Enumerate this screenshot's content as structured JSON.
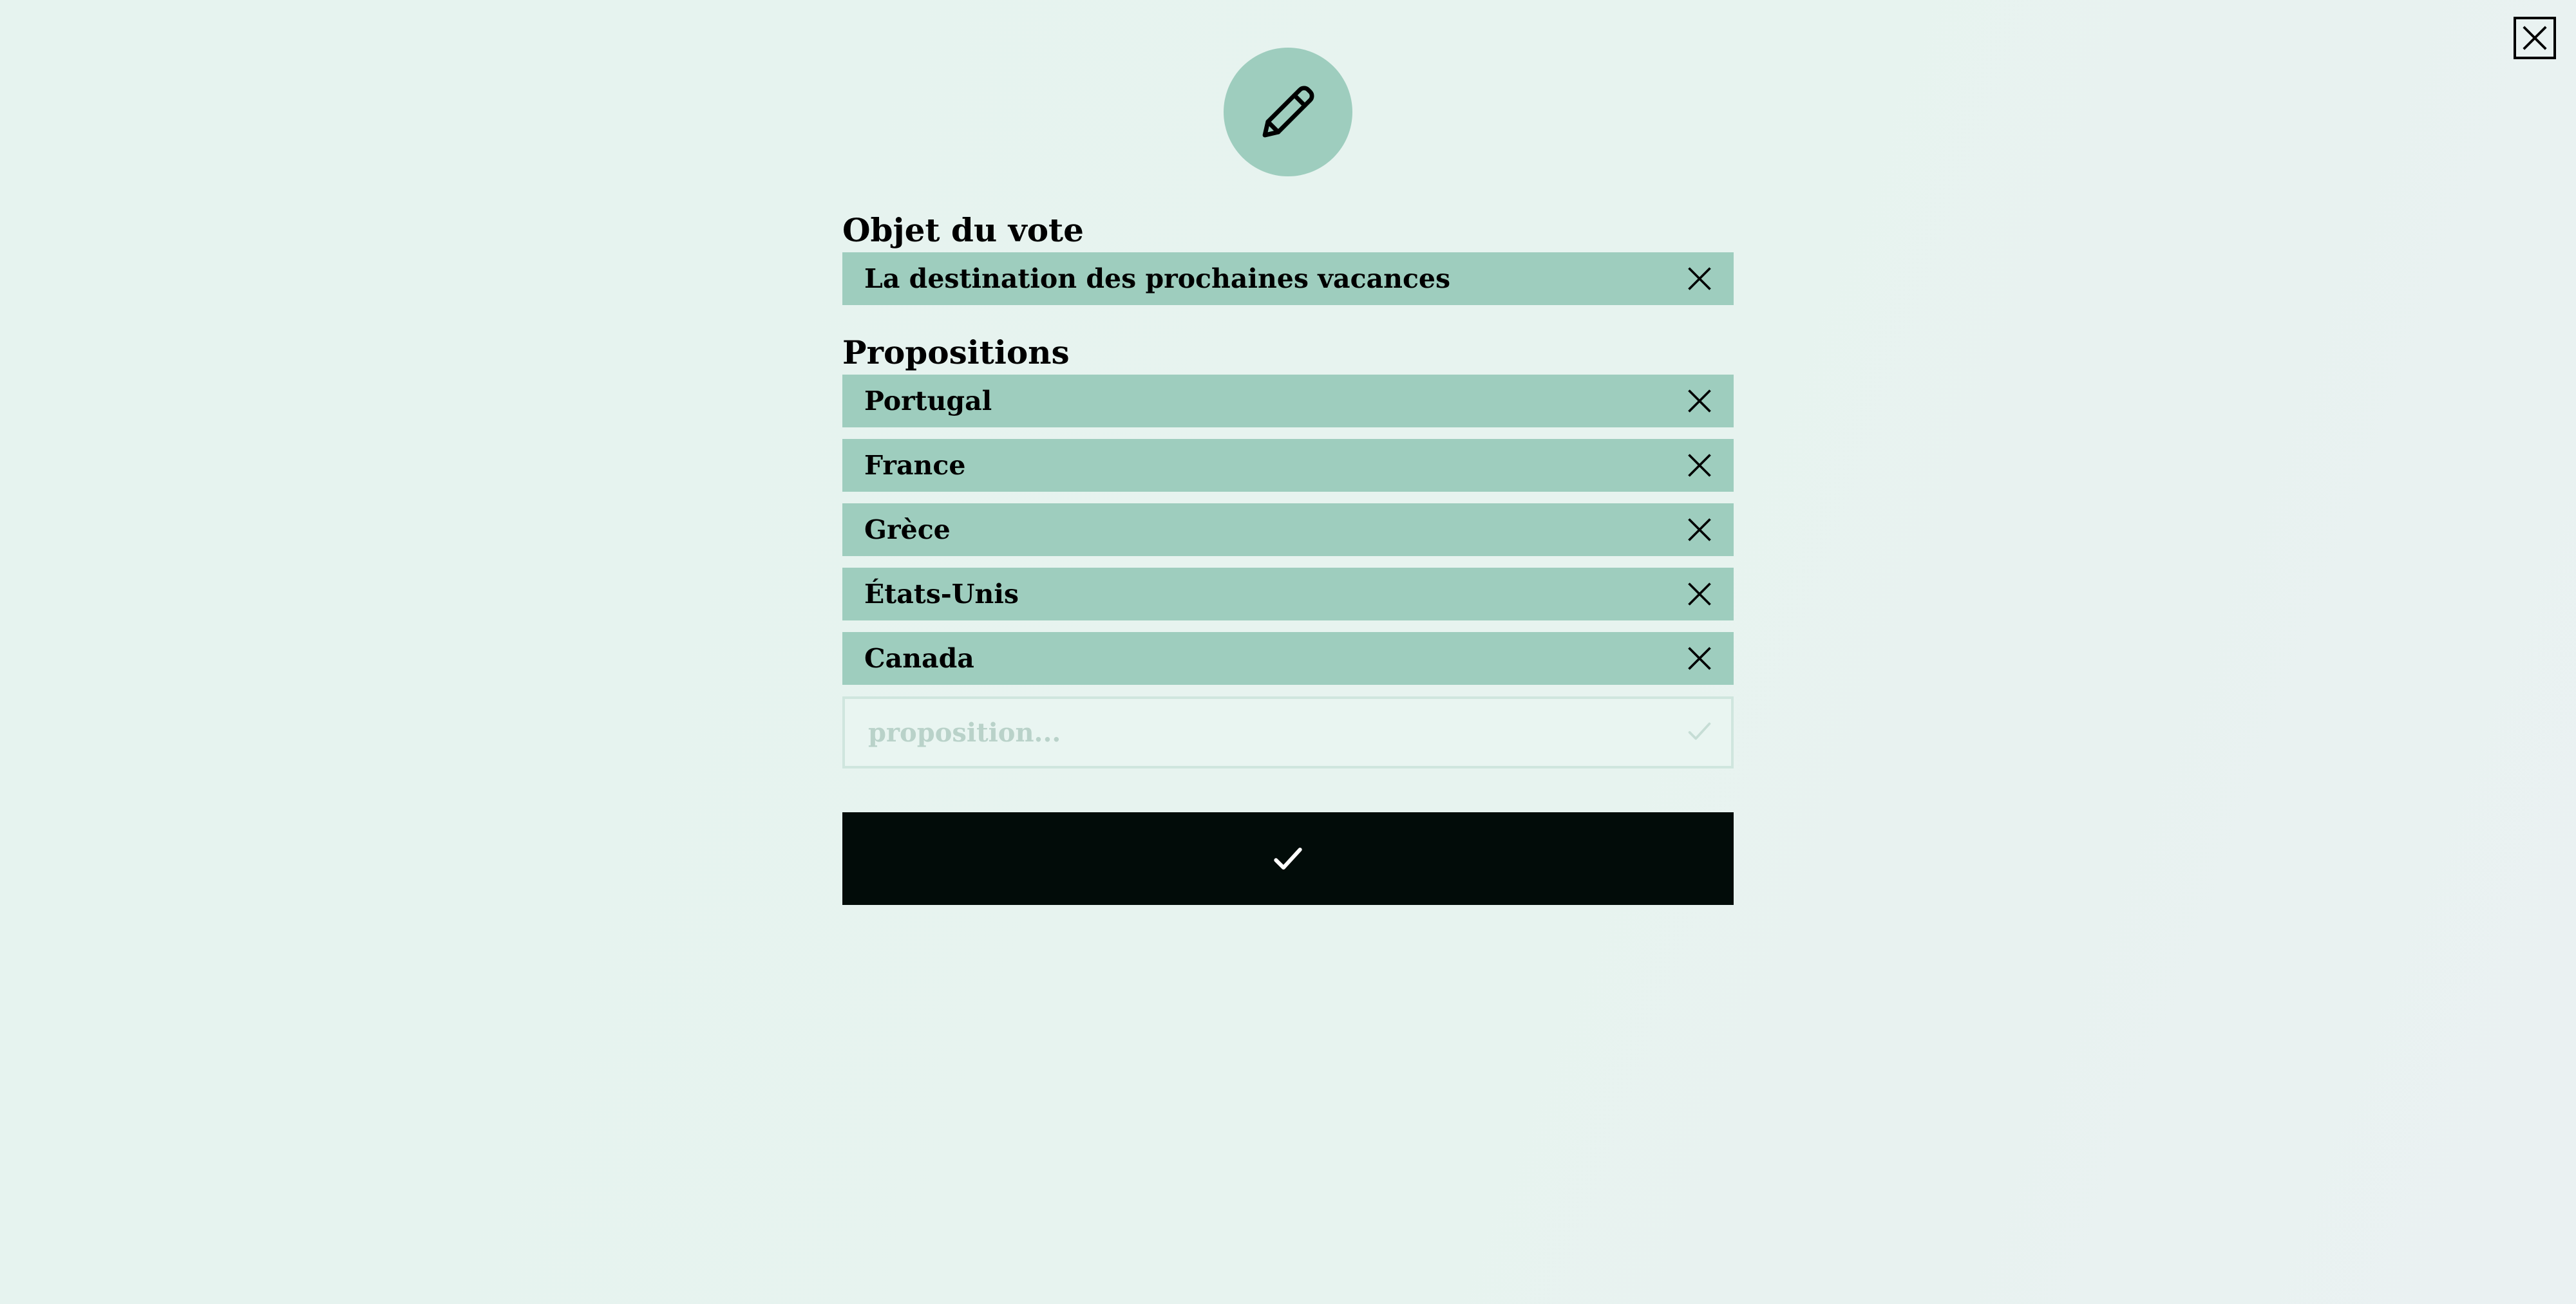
{
  "header": {
    "icon": "pencil-icon",
    "close_icon": "close-icon"
  },
  "form": {
    "subject_label": "Objet du vote",
    "subject_value": "La destination des prochaines vacances",
    "propositions_label": "Propositions",
    "propositions": [
      {
        "label": "Portugal"
      },
      {
        "label": "France"
      },
      {
        "label": "Grèce"
      },
      {
        "label": "États-Unis"
      },
      {
        "label": "Canada"
      }
    ],
    "new_proposition_placeholder": "proposition...",
    "new_proposition_value": "",
    "submit_icon": "check-icon"
  },
  "colors": {
    "accent": "#9ecdbe",
    "submit": "#020c09",
    "background": "#e6f3ef"
  }
}
